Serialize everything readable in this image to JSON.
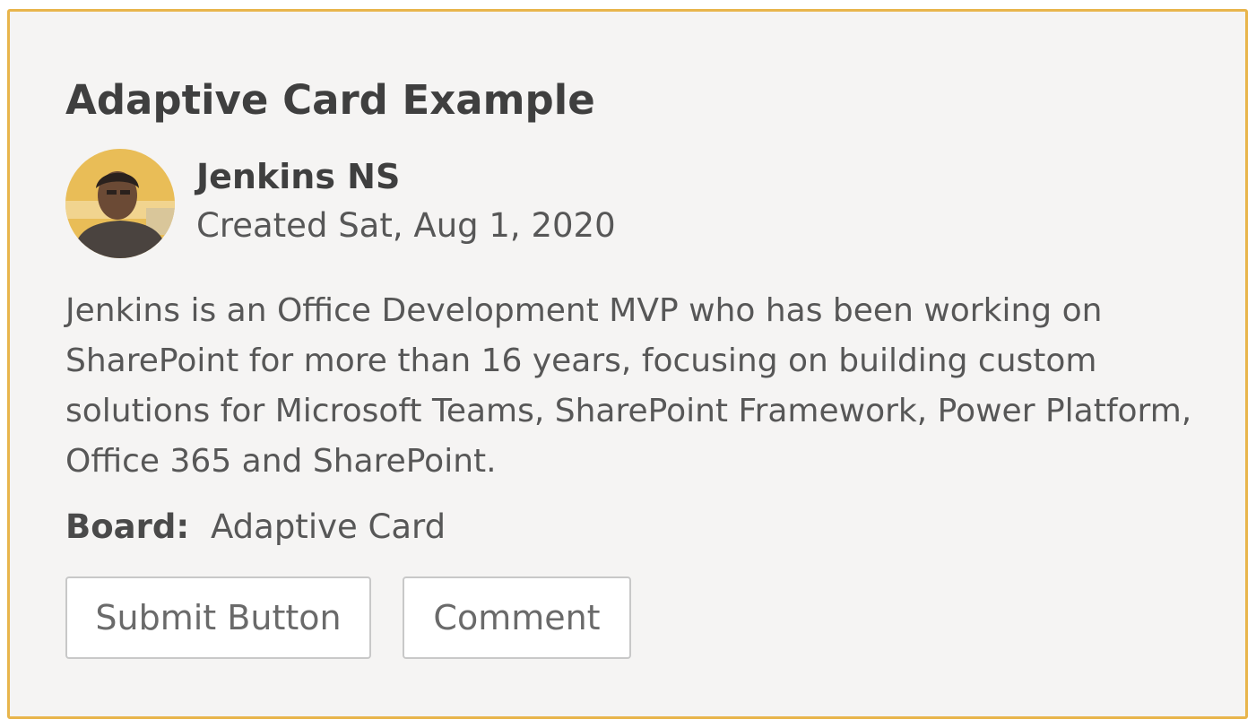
{
  "card": {
    "title": "Adaptive Card Example",
    "accent_color": "#e8b54c",
    "background_color": "#f5f4f3",
    "author": {
      "name": "Jenkins NS",
      "created": "Created Sat, Aug 1, 2020",
      "avatar_icon": "person-photo-avatar"
    },
    "description": "Jenkins is an Office Development MVP who has been working on SharePoint for more than 16 years, focusing on building custom solutions for Microsoft Teams, SharePoint Framework, Power Platform, Office 365 and SharePoint.",
    "facts": [
      {
        "title": "Board:",
        "value": "Adaptive Card"
      }
    ],
    "actions": [
      {
        "label": "Submit Button"
      },
      {
        "label": "Comment"
      }
    ]
  }
}
